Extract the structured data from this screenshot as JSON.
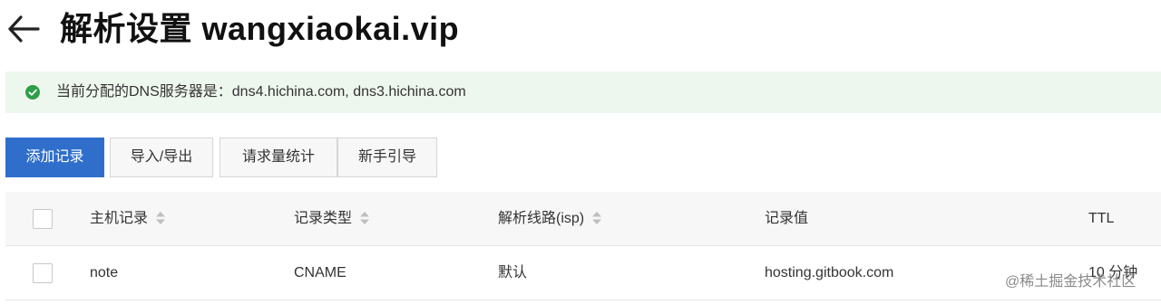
{
  "header": {
    "title": "解析设置 wangxiaokai.vip",
    "back_icon": "arrow-left-icon"
  },
  "notice": {
    "icon": "check-circle-icon",
    "color": "#2e9e48",
    "text": "当前分配的DNS服务器是：dns4.hichina.com, dns3.hichina.com"
  },
  "toolbar": {
    "add_record": "添加记录",
    "import_export": "导入/导出",
    "stats": "请求量统计",
    "guide": "新手引导",
    "primary_color": "#2f6fcb"
  },
  "table": {
    "columns": {
      "host": "主机记录",
      "type": "记录类型",
      "line": "解析线路(isp)",
      "value": "记录值",
      "ttl": "TTL"
    },
    "rows": [
      {
        "host": "note",
        "type": "CNAME",
        "line": "默认",
        "value": "hosting.gitbook.com",
        "ttl": "10 分钟"
      }
    ]
  },
  "watermark": "@稀土掘金技术社区"
}
